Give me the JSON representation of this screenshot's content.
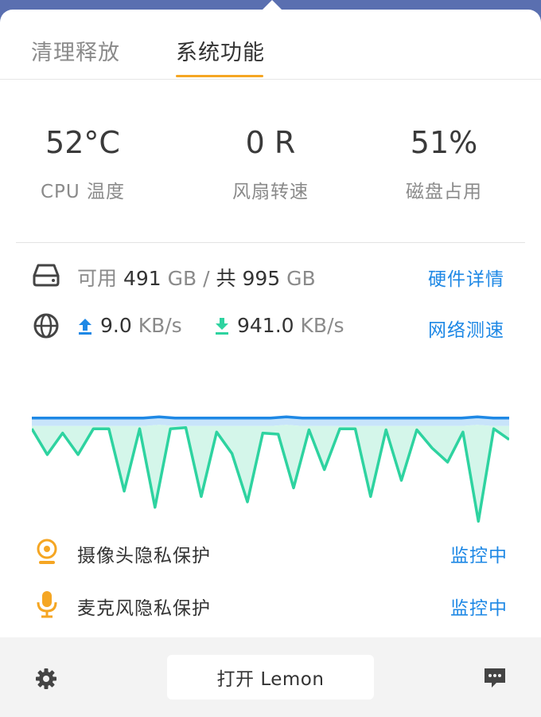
{
  "tabs": [
    {
      "label": "清理释放",
      "active": false
    },
    {
      "label": "系统功能",
      "active": true
    }
  ],
  "stats": {
    "cpu": {
      "value": "52°C",
      "label": "CPU 温度"
    },
    "fan": {
      "value": "0 R",
      "label": "风扇转速"
    },
    "disk": {
      "value": "51%",
      "label": "磁盘占用"
    }
  },
  "storage": {
    "available_prefix": "可用",
    "available_value": "491",
    "unit1": "GB /",
    "total_prefix": "共",
    "total_value": "995",
    "unit2": "GB",
    "link": "硬件详情",
    "icon": "hard-drive-icon"
  },
  "network": {
    "upload_value": "9.0",
    "upload_unit": "KB/s",
    "download_value": "941.0",
    "download_unit": "KB/s",
    "link": "网络测速",
    "icon": "globe-icon"
  },
  "chart_data": {
    "type": "area",
    "series": [
      {
        "color": "#1e88e5",
        "fill": "#c8e4fa",
        "values": [
          98,
          98,
          98,
          98,
          98,
          98,
          98,
          98,
          99,
          98,
          98,
          98,
          98,
          98,
          98,
          98,
          99,
          98,
          98,
          98,
          98,
          98,
          98,
          98,
          98,
          98,
          98,
          98,
          99,
          98,
          98
        ]
      },
      {
        "color": "#2ed3a0",
        "fill": "#d4f6ea",
        "values": [
          88,
          64,
          84,
          64,
          88,
          88,
          30,
          88,
          15,
          88,
          89,
          25,
          85,
          65,
          20,
          84,
          83,
          33,
          87,
          50,
          88,
          88,
          25,
          87,
          40,
          87,
          70,
          57,
          85,
          2,
          88,
          78
        ]
      }
    ],
    "grid": false,
    "axes": false
  },
  "privacy": [
    {
      "label": "摄像头隐私保护",
      "status": "监控中",
      "icon": "webcam-icon"
    },
    {
      "label": "麦克风隐私保护",
      "status": "监控中",
      "icon": "microphone-icon"
    }
  ],
  "footer": {
    "open_button": "打开 Lemon",
    "settings_icon": "gear-icon",
    "feedback_icon": "chat-bubble-icon"
  },
  "colors": {
    "accent_orange": "#f5a623",
    "link_blue": "#1e88e5",
    "green": "#2ed3a0"
  }
}
